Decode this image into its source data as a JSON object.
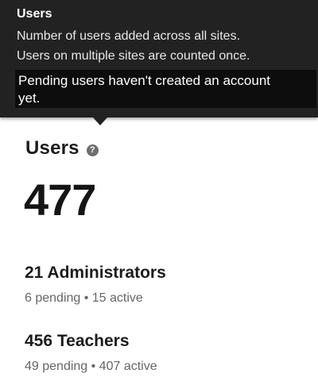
{
  "tooltip": {
    "title": "Users",
    "line1": "Number of users added across all sites.",
    "line2": "Users on multiple sites are counted once.",
    "highlight": "Pending users haven't created an account yet."
  },
  "card": {
    "title": "Users",
    "help_icon": "question-mark",
    "total": "477",
    "groups": [
      {
        "title": "21 Administrators",
        "sub": "6 pending • 15 active"
      },
      {
        "title": "456 Teachers",
        "sub": "49 pending • 407 active"
      }
    ]
  }
}
